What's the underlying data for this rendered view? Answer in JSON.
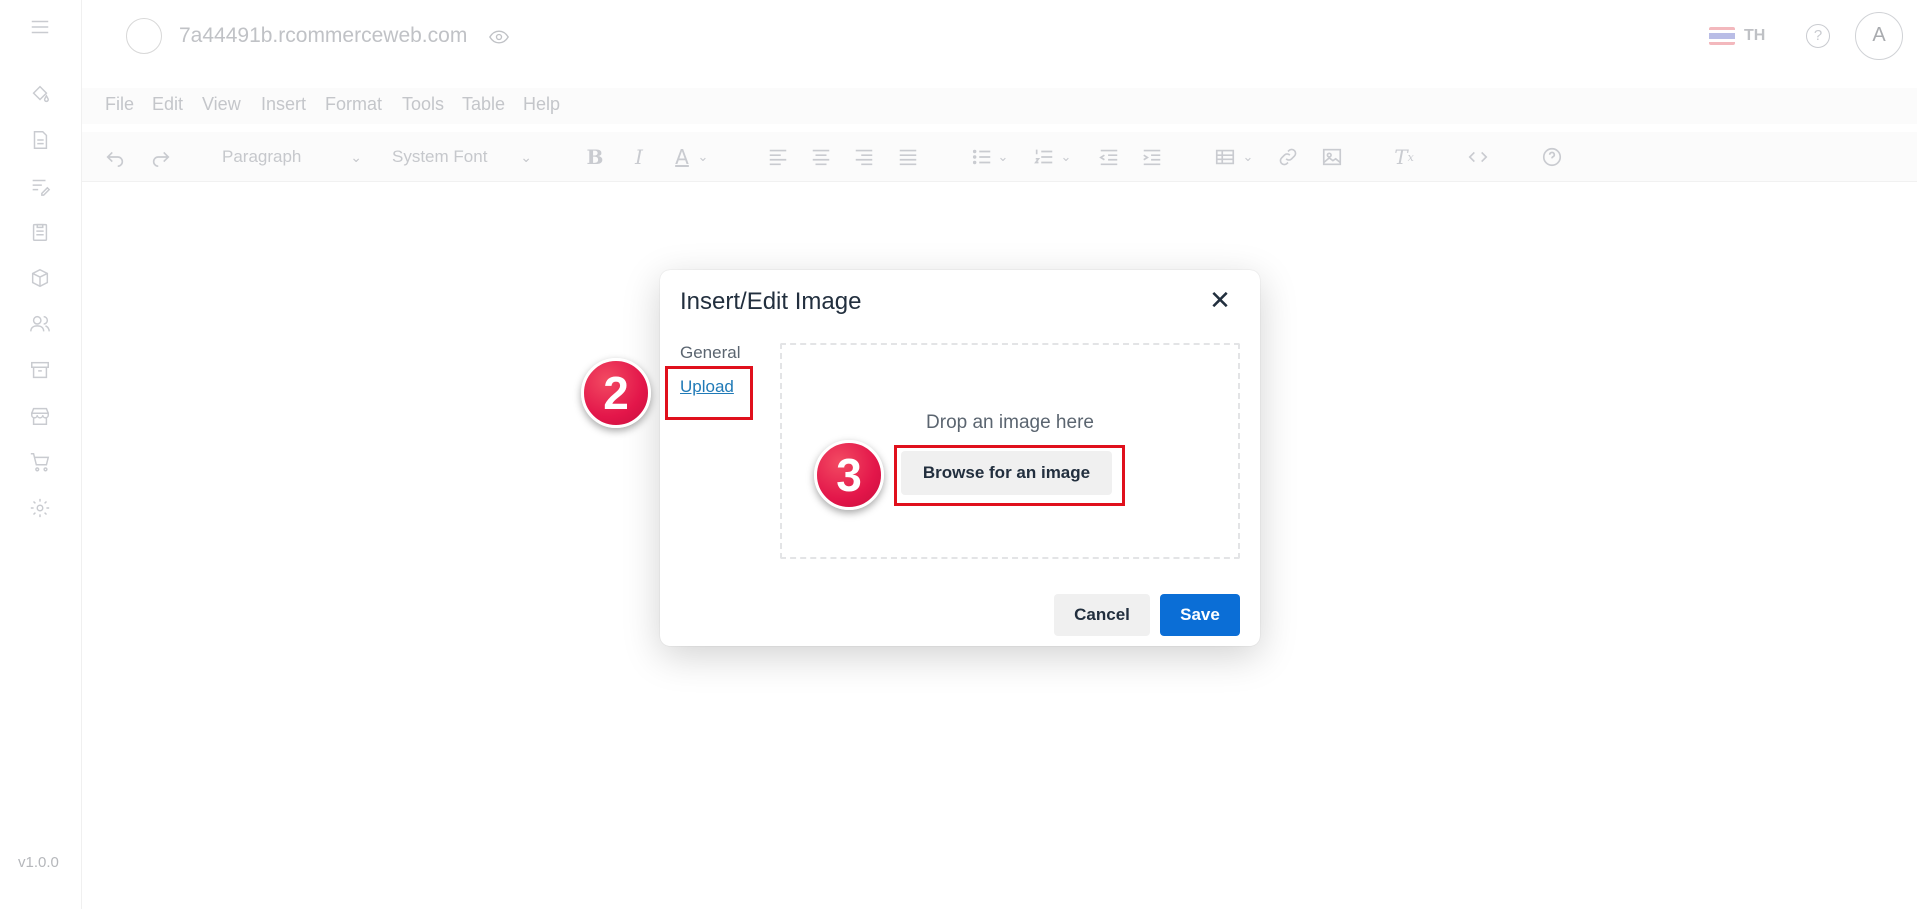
{
  "sidebar": {
    "icons": [
      "paint-bucket-icon",
      "document-icon",
      "edit-lines-icon",
      "clipboard-icon",
      "box-icon",
      "users-icon",
      "archive-icon",
      "store-icon",
      "cart-icon",
      "gear-icon"
    ],
    "version": "v1.0.0"
  },
  "header": {
    "site_name": "7a44491b.rcommerceweb.com",
    "language": "TH",
    "help_glyph": "?",
    "avatar_initial": "A"
  },
  "editor": {
    "menu": [
      "File",
      "Edit",
      "View",
      "Insert",
      "Format",
      "Tools",
      "Table",
      "Help"
    ],
    "block_format": "Paragraph",
    "font_family": "System Font"
  },
  "dialog": {
    "title": "Insert/Edit Image",
    "tabs": [
      "General",
      "Upload"
    ],
    "active_tab": "Upload",
    "drop_text": "Drop an image here",
    "browse_label": "Browse for an image",
    "cancel_label": "Cancel",
    "save_label": "Save",
    "close_glyph": "✕"
  },
  "annotations": {
    "step_upload": "2",
    "step_browse": "3",
    "highlight_color": "#e0101c",
    "badge_color": "#e3164a"
  },
  "colors": {
    "primary": "#0b6ed6",
    "link": "#207ab7"
  }
}
